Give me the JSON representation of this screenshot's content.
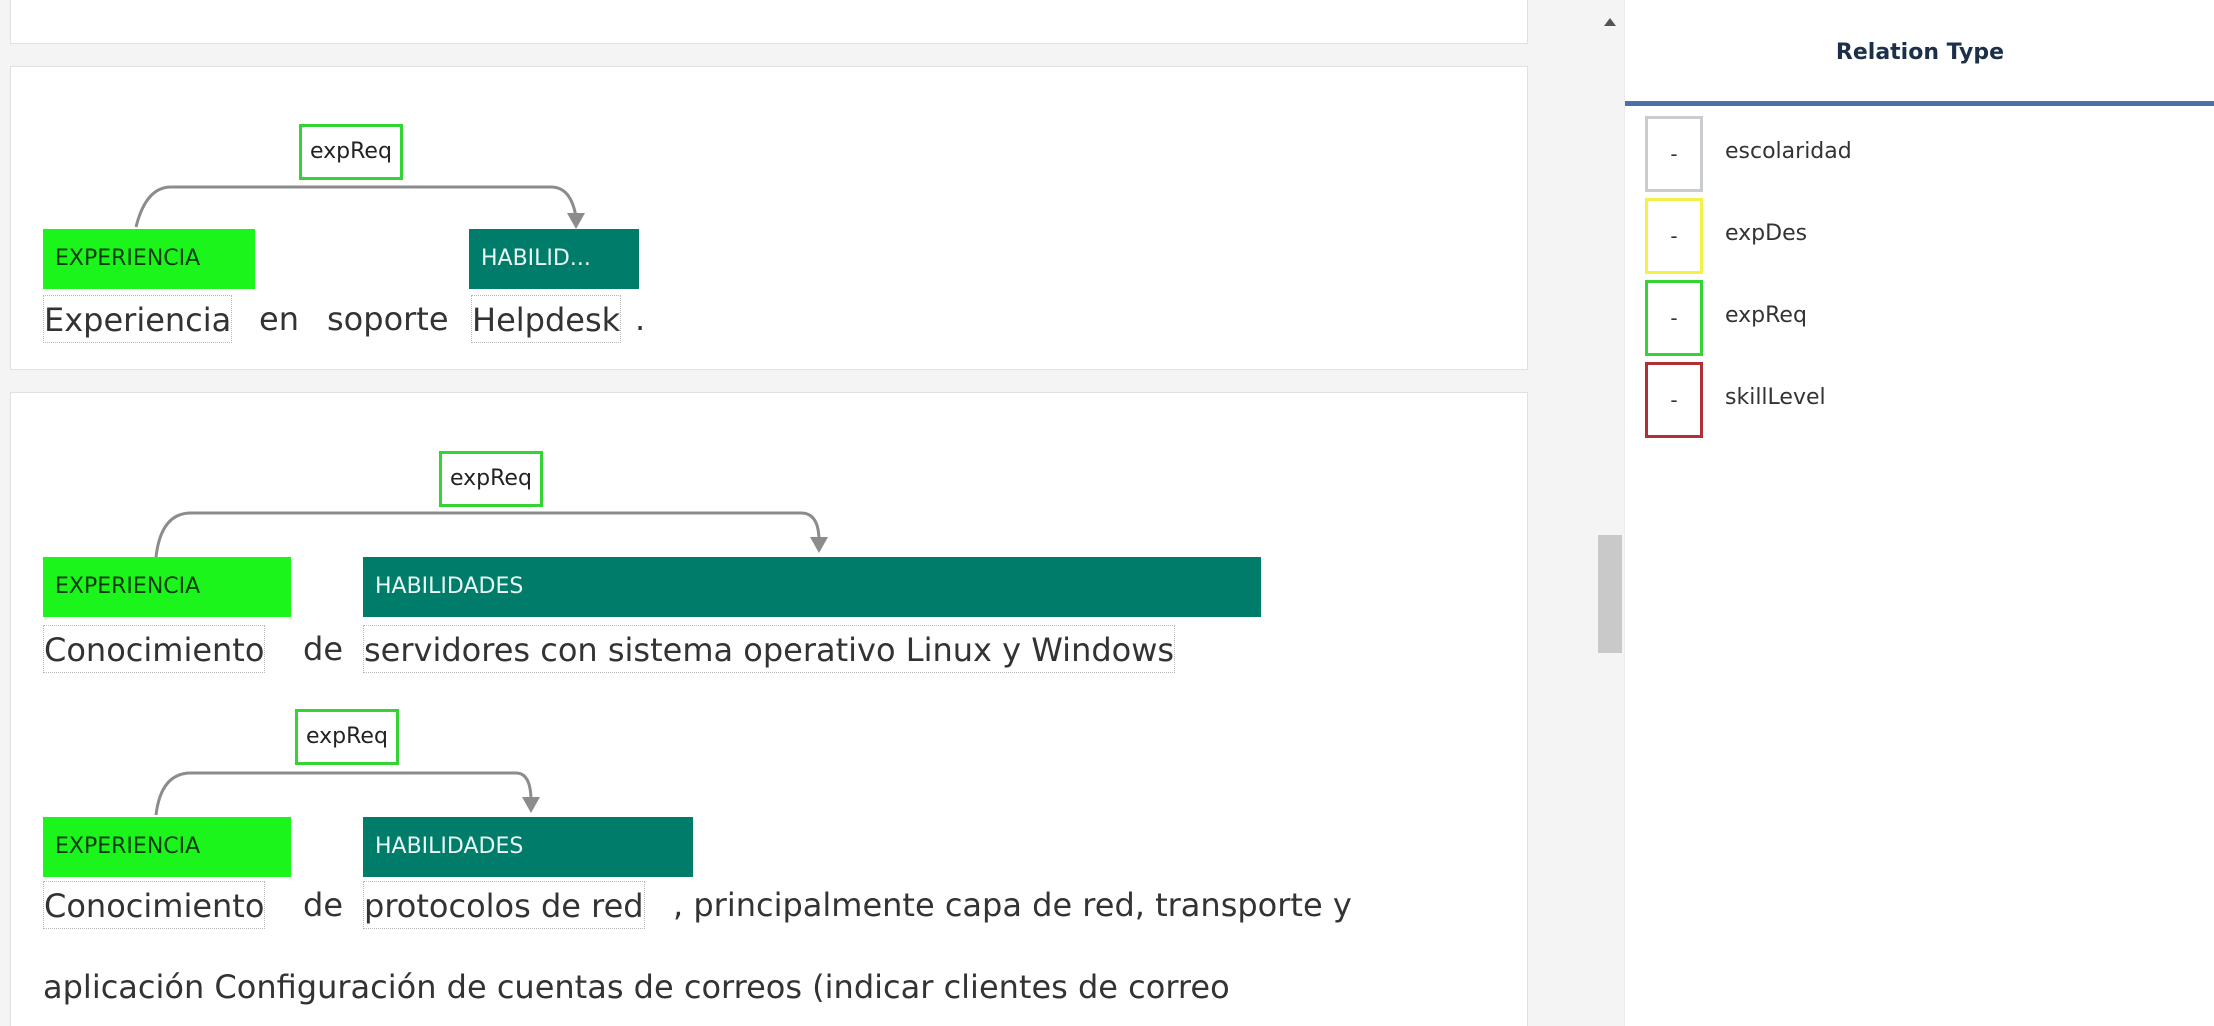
{
  "sentences": [
    {
      "relation": "expReq",
      "entity1": "EXPERIENCIA",
      "entity2": "HABILID...",
      "tokens": [
        "Experiencia",
        "en",
        "soporte",
        "Helpdesk",
        "."
      ]
    },
    {
      "relation": "expReq",
      "entity1": "EXPERIENCIA",
      "entity2": "HABILIDADES",
      "tokens": [
        "Conocimiento",
        "de",
        "servidores con sistema operativo Linux y Windows"
      ]
    },
    {
      "relation": "expReq",
      "entity1": "EXPERIENCIA",
      "entity2": "HABILIDADES",
      "tokens": [
        "Conocimiento",
        "de",
        "protocolos de red",
        ", principalmente capa de red, transporte y"
      ],
      "continuation": "aplicación  Configuración de cuentas de correos (indicar clientes de correo"
    }
  ],
  "sidebar": {
    "title": "Relation Type",
    "items": [
      {
        "label": "escolaridad",
        "symbol": "-",
        "color": "#c8ccd0"
      },
      {
        "label": "expDes",
        "symbol": "-",
        "color": "#f3f04a"
      },
      {
        "label": "expReq",
        "symbol": "-",
        "color": "#33d433"
      },
      {
        "label": "skillLevel",
        "symbol": "-",
        "color": "#b0303a"
      }
    ]
  },
  "colors": {
    "experiencia": "#1cf51c",
    "habilidades": "#007d6a",
    "relation_border": "#33d433",
    "accent_rule": "#4b6fa8"
  }
}
